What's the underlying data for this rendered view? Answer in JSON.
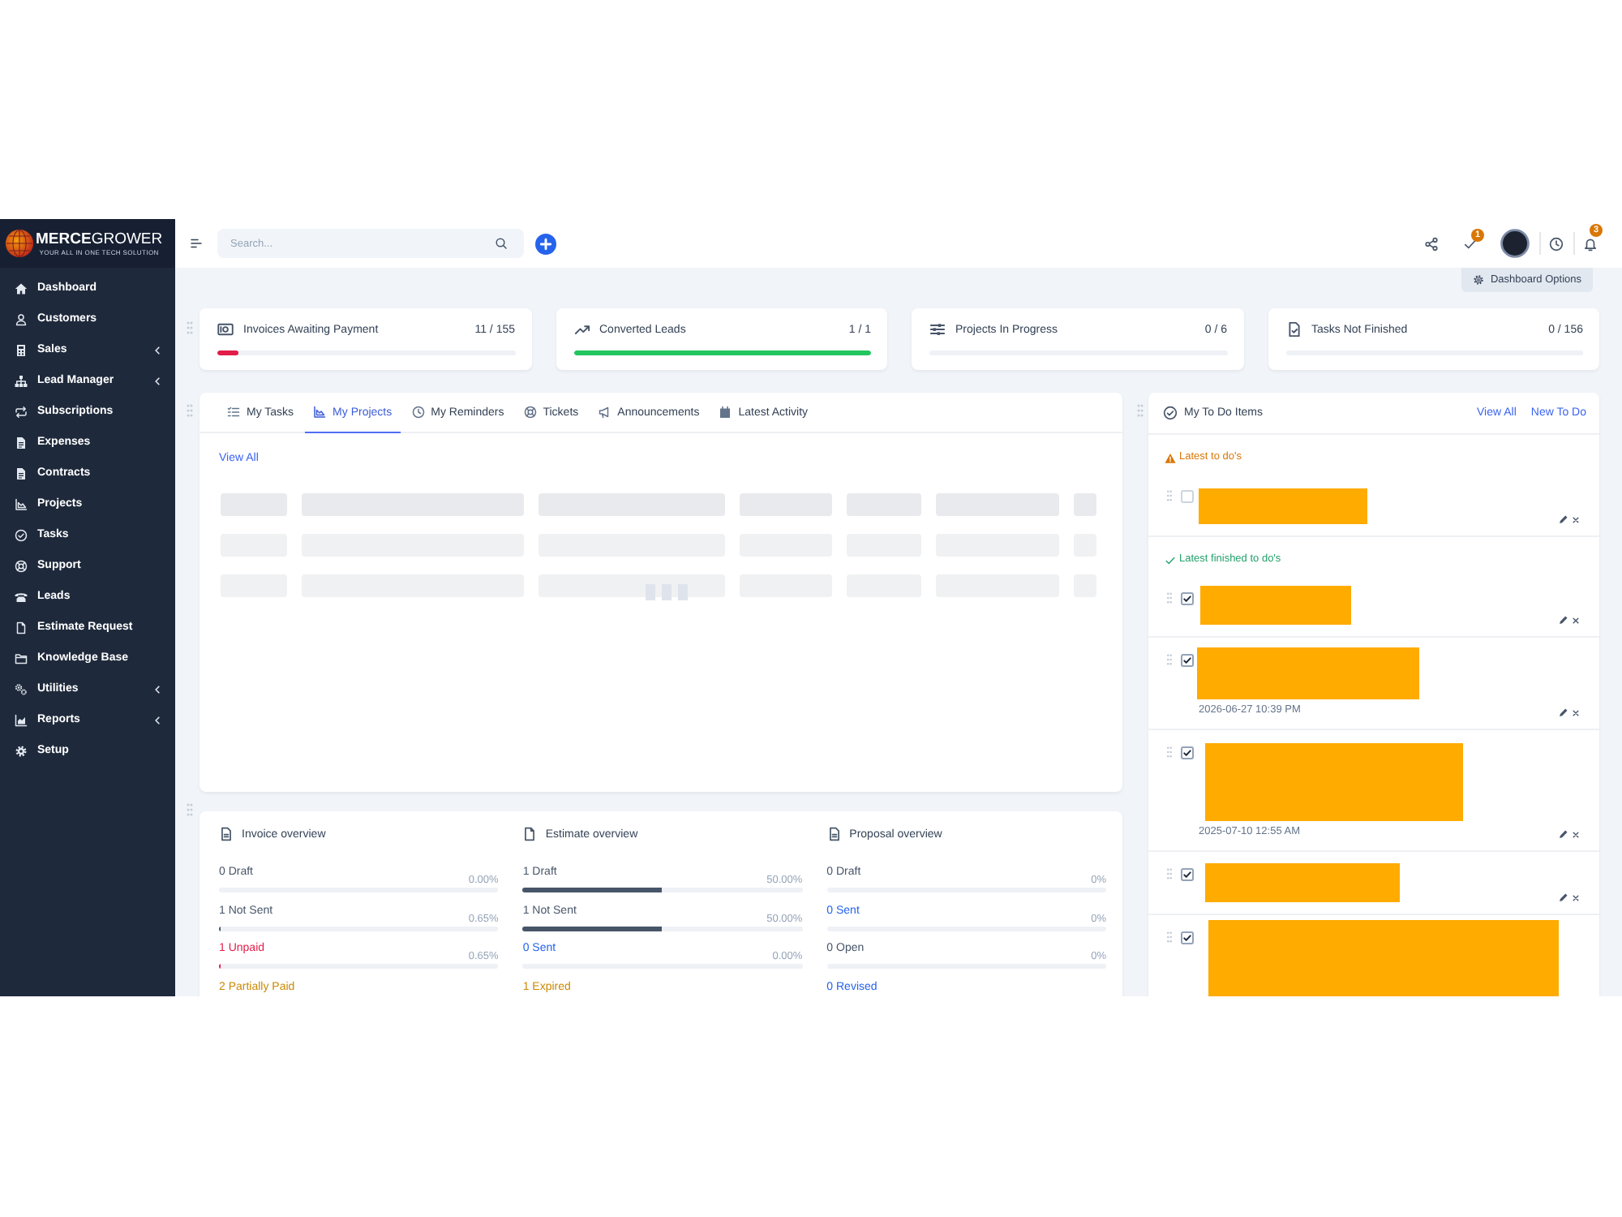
{
  "sidebar": {
    "brand": "**MERCE**GROWER",
    "tagline": "YOUR ALL IN ONE TECH SOLUTION",
    "items": [
      {
        "label": "Dashboard",
        "kind": "link"
      },
      {
        "label": "Customers",
        "kind": "link"
      },
      {
        "label": "Sales",
        "kind": "group"
      },
      {
        "label": "Lead Manager",
        "kind": "group"
      },
      {
        "label": "Subscriptions",
        "kind": "link"
      },
      {
        "label": "Expenses",
        "kind": "link"
      },
      {
        "label": "Contracts",
        "kind": "link"
      },
      {
        "label": "Projects",
        "kind": "link"
      },
      {
        "label": "Tasks",
        "kind": "link"
      },
      {
        "label": "Support",
        "kind": "link"
      },
      {
        "label": "Leads",
        "kind": "link"
      },
      {
        "label": "Estimate Request",
        "kind": "link"
      },
      {
        "label": "Knowledge Base",
        "kind": "link"
      },
      {
        "label": "Utilities",
        "kind": "group"
      },
      {
        "label": "Reports",
        "kind": "group"
      },
      {
        "label": "Setup",
        "kind": "link"
      }
    ]
  },
  "topbar": {
    "search": {
      "placeholder": "Search..."
    },
    "task_badge": "1",
    "notification_badge": "3"
  },
  "dashboard_options": "Dashboard Options",
  "stats": [
    {
      "title": "Invoices Awaiting Payment",
      "value": "11 / 155",
      "level": 0.071,
      "color": "#e11d48"
    },
    {
      "title": "Converted Leads",
      "value": "1 / 1",
      "level": 1,
      "color": "#22c55e"
    },
    {
      "title": "Projects In Progress",
      "value": "0 / 6",
      "level": 0
    },
    {
      "title": "Tasks Not Finished",
      "value": "0 / 156",
      "level": 0
    }
  ],
  "widgets": {
    "tabs": [
      {
        "label": "My Tasks",
        "selected": false
      },
      {
        "label": "My Projects",
        "selected": true
      },
      {
        "label": "My Reminders",
        "selected": false
      },
      {
        "label": "Tickets",
        "selected": false
      },
      {
        "label": "Announcements",
        "selected": false
      },
      {
        "label": "Latest Activity",
        "selected": false
      }
    ],
    "view_all": "View All",
    "loading": true
  },
  "overview": [
    {
      "title": "Invoice overview",
      "rows": [
        {
          "label": "0 Draft",
          "percent": "0.00%",
          "level": 0,
          "color": "#475569"
        },
        {
          "label": "1 Not Sent",
          "percent": "0.65%",
          "level": 0.0065,
          "color": "#475569"
        },
        {
          "label": "1 Unpaid",
          "percent": "0.65%",
          "level": 0.0065,
          "color": "#e11d48"
        },
        {
          "label": "2 Partially Paid",
          "color": "#ca8a04"
        }
      ]
    },
    {
      "title": "Estimate overview",
      "rows": [
        {
          "label": "1 Draft",
          "percent": "50.00%",
          "level": 0.5,
          "color": "#475569"
        },
        {
          "label": "1 Not Sent",
          "percent": "50.00%",
          "level": 0.5,
          "color": "#475569"
        },
        {
          "label": "0 Sent",
          "percent": "0.00%",
          "level": 0,
          "color": "#2563eb"
        },
        {
          "label": "1 Expired",
          "color": "#ca8a04"
        }
      ]
    },
    {
      "title": "Proposal overview",
      "rows": [
        {
          "label": "0 Draft",
          "percent": "0%",
          "level": 0,
          "color": "#475569"
        },
        {
          "label": "0 Sent",
          "percent": "0%",
          "level": 0,
          "color": "#2563eb"
        },
        {
          "label": "0 Open",
          "percent": "0%",
          "level": 0,
          "color": "#475569"
        },
        {
          "label": "0 Revised",
          "color": "#2563eb"
        }
      ]
    }
  ],
  "todo": {
    "title": "My To Do Items",
    "links": [
      "View All",
      "New To Do"
    ],
    "sections": [
      {
        "kind": "pending",
        "title": "Latest to do's",
        "items": [
          {
            "checked": false,
            "redacted": true
          }
        ]
      },
      {
        "kind": "finished",
        "title": "Latest finished to do's",
        "items": [
          {
            "checked": true,
            "redacted": true
          },
          {
            "checked": true,
            "redacted": true,
            "date": "2026-06-27 10:39 PM"
          },
          {
            "checked": true,
            "redacted": true,
            "date": "2025-07-10 12:55 AM"
          },
          {
            "checked": true,
            "redacted": true
          },
          {
            "checked": true,
            "redacted": true
          }
        ]
      }
    ]
  }
}
